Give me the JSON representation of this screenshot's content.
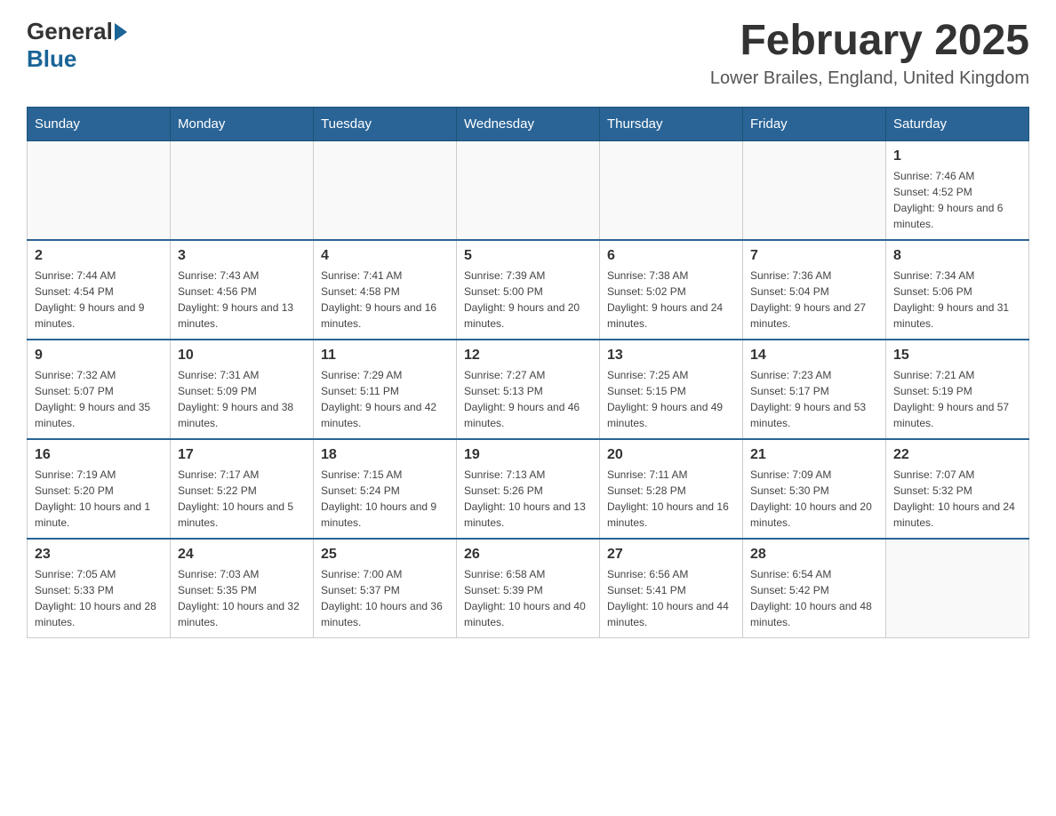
{
  "logo": {
    "general": "General",
    "blue": "Blue"
  },
  "title": "February 2025",
  "subtitle": "Lower Brailes, England, United Kingdom",
  "days_of_week": [
    "Sunday",
    "Monday",
    "Tuesday",
    "Wednesday",
    "Thursday",
    "Friday",
    "Saturday"
  ],
  "weeks": [
    [
      {
        "day": "",
        "info": ""
      },
      {
        "day": "",
        "info": ""
      },
      {
        "day": "",
        "info": ""
      },
      {
        "day": "",
        "info": ""
      },
      {
        "day": "",
        "info": ""
      },
      {
        "day": "",
        "info": ""
      },
      {
        "day": "1",
        "info": "Sunrise: 7:46 AM\nSunset: 4:52 PM\nDaylight: 9 hours and 6 minutes."
      }
    ],
    [
      {
        "day": "2",
        "info": "Sunrise: 7:44 AM\nSunset: 4:54 PM\nDaylight: 9 hours and 9 minutes."
      },
      {
        "day": "3",
        "info": "Sunrise: 7:43 AM\nSunset: 4:56 PM\nDaylight: 9 hours and 13 minutes."
      },
      {
        "day": "4",
        "info": "Sunrise: 7:41 AM\nSunset: 4:58 PM\nDaylight: 9 hours and 16 minutes."
      },
      {
        "day": "5",
        "info": "Sunrise: 7:39 AM\nSunset: 5:00 PM\nDaylight: 9 hours and 20 minutes."
      },
      {
        "day": "6",
        "info": "Sunrise: 7:38 AM\nSunset: 5:02 PM\nDaylight: 9 hours and 24 minutes."
      },
      {
        "day": "7",
        "info": "Sunrise: 7:36 AM\nSunset: 5:04 PM\nDaylight: 9 hours and 27 minutes."
      },
      {
        "day": "8",
        "info": "Sunrise: 7:34 AM\nSunset: 5:06 PM\nDaylight: 9 hours and 31 minutes."
      }
    ],
    [
      {
        "day": "9",
        "info": "Sunrise: 7:32 AM\nSunset: 5:07 PM\nDaylight: 9 hours and 35 minutes."
      },
      {
        "day": "10",
        "info": "Sunrise: 7:31 AM\nSunset: 5:09 PM\nDaylight: 9 hours and 38 minutes."
      },
      {
        "day": "11",
        "info": "Sunrise: 7:29 AM\nSunset: 5:11 PM\nDaylight: 9 hours and 42 minutes."
      },
      {
        "day": "12",
        "info": "Sunrise: 7:27 AM\nSunset: 5:13 PM\nDaylight: 9 hours and 46 minutes."
      },
      {
        "day": "13",
        "info": "Sunrise: 7:25 AM\nSunset: 5:15 PM\nDaylight: 9 hours and 49 minutes."
      },
      {
        "day": "14",
        "info": "Sunrise: 7:23 AM\nSunset: 5:17 PM\nDaylight: 9 hours and 53 minutes."
      },
      {
        "day": "15",
        "info": "Sunrise: 7:21 AM\nSunset: 5:19 PM\nDaylight: 9 hours and 57 minutes."
      }
    ],
    [
      {
        "day": "16",
        "info": "Sunrise: 7:19 AM\nSunset: 5:20 PM\nDaylight: 10 hours and 1 minute."
      },
      {
        "day": "17",
        "info": "Sunrise: 7:17 AM\nSunset: 5:22 PM\nDaylight: 10 hours and 5 minutes."
      },
      {
        "day": "18",
        "info": "Sunrise: 7:15 AM\nSunset: 5:24 PM\nDaylight: 10 hours and 9 minutes."
      },
      {
        "day": "19",
        "info": "Sunrise: 7:13 AM\nSunset: 5:26 PM\nDaylight: 10 hours and 13 minutes."
      },
      {
        "day": "20",
        "info": "Sunrise: 7:11 AM\nSunset: 5:28 PM\nDaylight: 10 hours and 16 minutes."
      },
      {
        "day": "21",
        "info": "Sunrise: 7:09 AM\nSunset: 5:30 PM\nDaylight: 10 hours and 20 minutes."
      },
      {
        "day": "22",
        "info": "Sunrise: 7:07 AM\nSunset: 5:32 PM\nDaylight: 10 hours and 24 minutes."
      }
    ],
    [
      {
        "day": "23",
        "info": "Sunrise: 7:05 AM\nSunset: 5:33 PM\nDaylight: 10 hours and 28 minutes."
      },
      {
        "day": "24",
        "info": "Sunrise: 7:03 AM\nSunset: 5:35 PM\nDaylight: 10 hours and 32 minutes."
      },
      {
        "day": "25",
        "info": "Sunrise: 7:00 AM\nSunset: 5:37 PM\nDaylight: 10 hours and 36 minutes."
      },
      {
        "day": "26",
        "info": "Sunrise: 6:58 AM\nSunset: 5:39 PM\nDaylight: 10 hours and 40 minutes."
      },
      {
        "day": "27",
        "info": "Sunrise: 6:56 AM\nSunset: 5:41 PM\nDaylight: 10 hours and 44 minutes."
      },
      {
        "day": "28",
        "info": "Sunrise: 6:54 AM\nSunset: 5:42 PM\nDaylight: 10 hours and 48 minutes."
      },
      {
        "day": "",
        "info": ""
      }
    ]
  ]
}
